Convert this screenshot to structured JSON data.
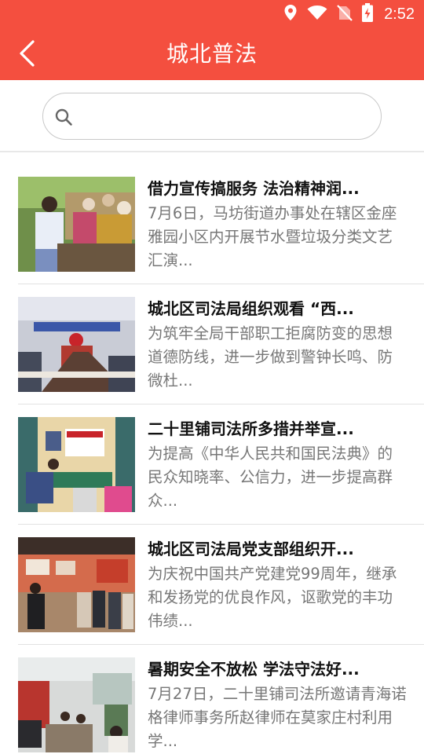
{
  "status": {
    "time": "2:52",
    "icons": [
      "location-icon",
      "wifi-icon",
      "no-sim-icon",
      "battery-charging-icon"
    ]
  },
  "header": {
    "title": "城北普法",
    "back_icon": "chevron-left-icon",
    "bg_color": "#f44f3f"
  },
  "search": {
    "value": "",
    "placeholder": "",
    "icon": "search-icon"
  },
  "news": [
    {
      "title": "借力宣传搞服务 法治精神润...",
      "summary": "7月6日，马坊街道办事处在辖区金座雅园小区内开展节水暨垃圾分类文艺汇演..."
    },
    {
      "title": "城北区司法局组织观看 “西...",
      "summary": "为筑牢全局干部职工拒腐防变的思想道德防线，进一步做到警钟长鸣、防微杜..."
    },
    {
      "title": "二十里铺司法所多措并举宣...",
      "summary": "为提高《中华人民共和国民法典》的民众知晓率、公信力，进一步提高群众..."
    },
    {
      "title": "城北区司法局党支部组织开...",
      "summary": "为庆祝中国共产党建党99周年，继承和发扬党的优良作风，讴歌党的丰功伟绩..."
    },
    {
      "title": "暑期安全不放松 学法守法好...",
      "summary": "7月27日，二十里铺司法所邀请青海诺格律师事务所赵律师在莫家庄村利用学..."
    }
  ]
}
